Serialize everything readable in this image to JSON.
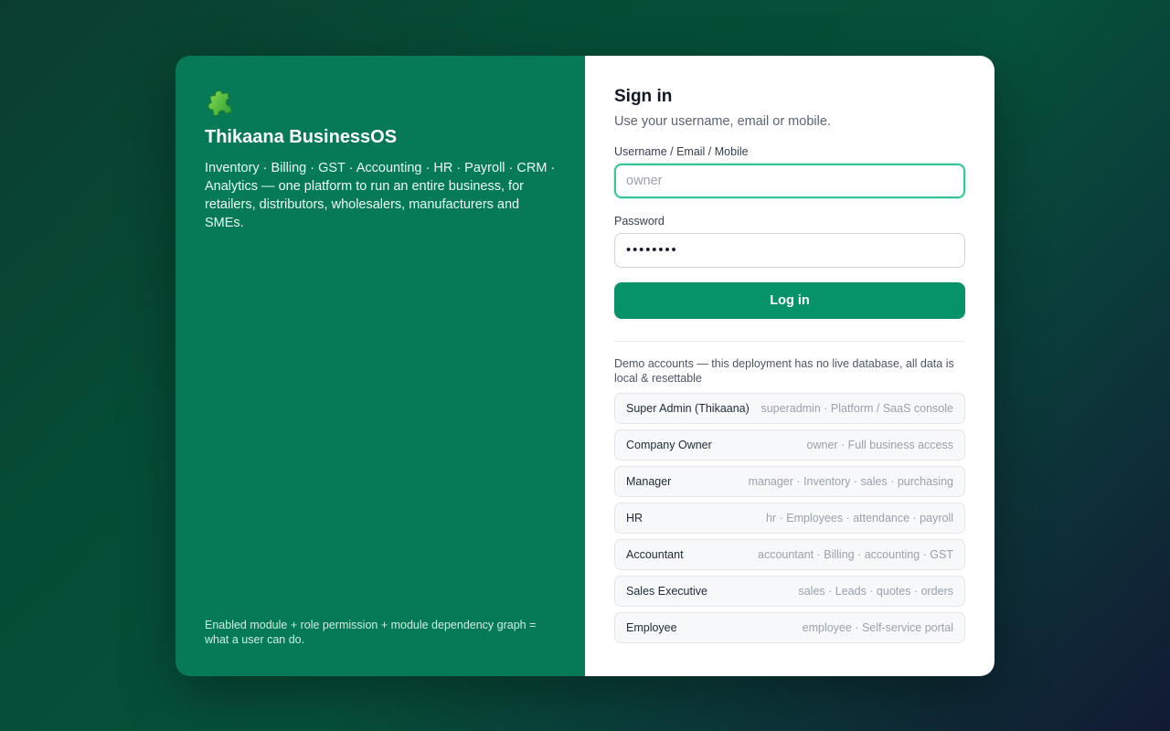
{
  "brand": {
    "icon": "puzzle-piece-icon",
    "name": "Thikaana BusinessOS",
    "tagline": "Inventory · Billing · GST · Accounting · HR · Payroll · CRM · Analytics — one platform to run an entire business, for retailers, distributors, wholesalers, manufacturers and SMEs.",
    "footnote": "Enabled module + role permission + module dependency graph = what a user can do."
  },
  "signin": {
    "title": "Sign in",
    "subtitle": "Use your username, email or mobile.",
    "username_label": "Username / Email / Mobile",
    "username_placeholder": "owner",
    "username_value": "",
    "password_label": "Password",
    "password_value": "••••••••",
    "login_label": "Log in"
  },
  "demo": {
    "note": "Demo accounts — this deployment has no live database, all data is local & resettable",
    "accounts": [
      {
        "role": "Super Admin (Thikaana)",
        "desc": "superadmin · Platform / SaaS console"
      },
      {
        "role": "Company Owner",
        "desc": "owner · Full business access"
      },
      {
        "role": "Manager",
        "desc": "manager · Inventory · sales · purchasing"
      },
      {
        "role": "HR",
        "desc": "hr · Employees · attendance · payroll"
      },
      {
        "role": "Accountant",
        "desc": "accountant · Billing · accounting · GST"
      },
      {
        "role": "Sales Executive",
        "desc": "sales · Leads · quotes · orders"
      },
      {
        "role": "Employee",
        "desc": "employee · Self-service portal"
      }
    ]
  },
  "colors": {
    "brand_panel": "#067a56",
    "primary_button": "#07936a",
    "focus_ring": "#34c795"
  }
}
